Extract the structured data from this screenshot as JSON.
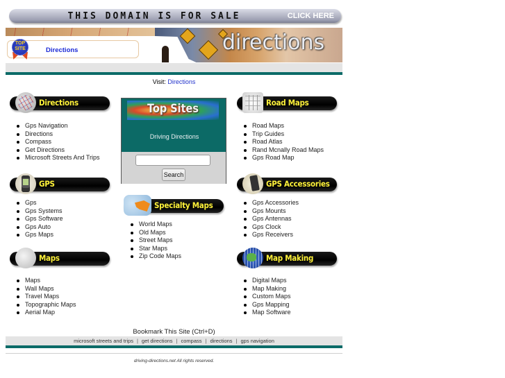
{
  "sale_banner": {
    "text": "THIS DOMAIN IS FOR SALE",
    "cta": "CLICK HERE"
  },
  "header": {
    "badge_text": "TOP SITE",
    "link": "Directions",
    "logo_word": "directions"
  },
  "visit": {
    "label": "Visit:",
    "link": "Directions"
  },
  "categories": {
    "directions": {
      "title": "Directions",
      "icon": "road-map-globe-icon",
      "links": [
        "Gps Navigation",
        "Directions",
        "Compass",
        "Get Directions",
        "Microsoft Streets And Trips"
      ]
    },
    "gps": {
      "title": "GPS",
      "icon": "gps-device-icon",
      "links": [
        "Gps",
        "Gps Systems",
        "Gps Software",
        "Gps Auto",
        "Gps Maps"
      ]
    },
    "maps": {
      "title": "Maps",
      "icon": "world-map-globe-icon",
      "links": [
        "Maps",
        "Wall Maps",
        "Travel Maps",
        "Topographic Maps",
        "Aerial Map"
      ]
    },
    "road_maps": {
      "title": "Road Maps",
      "icon": "road-atlas-icon",
      "links": [
        "Road Maps",
        "Trip Guides",
        "Road Atlas",
        "Rand Mcnally Road Maps",
        "Gps Road Map"
      ]
    },
    "specialty_maps": {
      "title": "Specialty Maps",
      "icon": "us-map-icon",
      "links": [
        "World Maps",
        "Old Maps",
        "Street Maps",
        "Star Maps",
        "Zip Code Maps"
      ]
    },
    "gps_accessories": {
      "title": "GPS Accessories",
      "icon": "gps-mount-icon",
      "links": [
        "Gps Accessories",
        "Gps Mounts",
        "Gps Antennas",
        "Gps Clock",
        "Gps Receivers"
      ]
    },
    "map_making": {
      "title": "Map Making",
      "icon": "earth-globe-icon",
      "links": [
        "Digital Maps",
        "Map Making",
        "Custom Maps",
        "Gps Mapping",
        "Map Software"
      ]
    }
  },
  "top_sites": {
    "title": "Top Sites",
    "link": "Driving Directions",
    "search_value": "",
    "search_button": "Search"
  },
  "footer": {
    "bookmark": "Bookmark This Site (Ctrl+D)",
    "links": [
      "microsoft streets and trips",
      "get directions",
      "compass",
      "directions",
      "gps navigation"
    ],
    "separator": "|",
    "copyright": "driving-directions.net All rights reserved."
  },
  "colors": {
    "teal": "#0b6b68",
    "category_title": "#fff23a",
    "link_blue": "#2233cc",
    "gray_bar": "#e4e4e4"
  }
}
